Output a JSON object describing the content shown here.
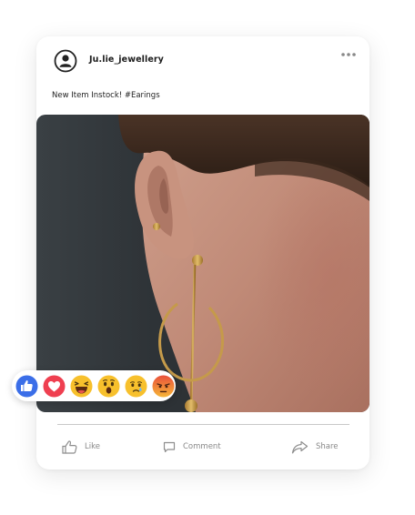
{
  "post": {
    "username": "Ju.lie_jewellery",
    "caption": "New Item Instock! #Earings",
    "image_alt": "photo-earring"
  },
  "actions": {
    "like_label": "Like",
    "comment_label": "Comment",
    "share_label": "Share"
  },
  "reactions": [
    "like",
    "love",
    "haha",
    "wow",
    "sad",
    "angry"
  ],
  "colors": {
    "like_blue": "#3b6ee8",
    "love_red": "#ef3f50",
    "emoji_yellow": "#f7c02c",
    "angry_orange": "#f07732",
    "icon_gray": "#8e8e8e"
  }
}
